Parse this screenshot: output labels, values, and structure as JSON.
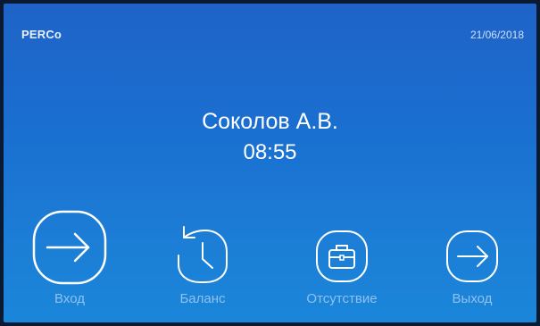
{
  "header": {
    "logo": "PERCo",
    "date": "21/06/2018"
  },
  "main": {
    "user_name": "Соколов А.В.",
    "time": "08:55"
  },
  "actions": [
    {
      "label": "Вход",
      "icon": "login-arrow-icon"
    },
    {
      "label": "Баланс",
      "icon": "clock-history-icon"
    },
    {
      "label": "Отсутствие",
      "icon": "briefcase-icon"
    },
    {
      "label": "Выход",
      "icon": "logout-arrow-icon"
    }
  ],
  "colors": {
    "background_top": "#1f63c8",
    "background_bottom": "#1a86da",
    "text": "#ffffff"
  }
}
